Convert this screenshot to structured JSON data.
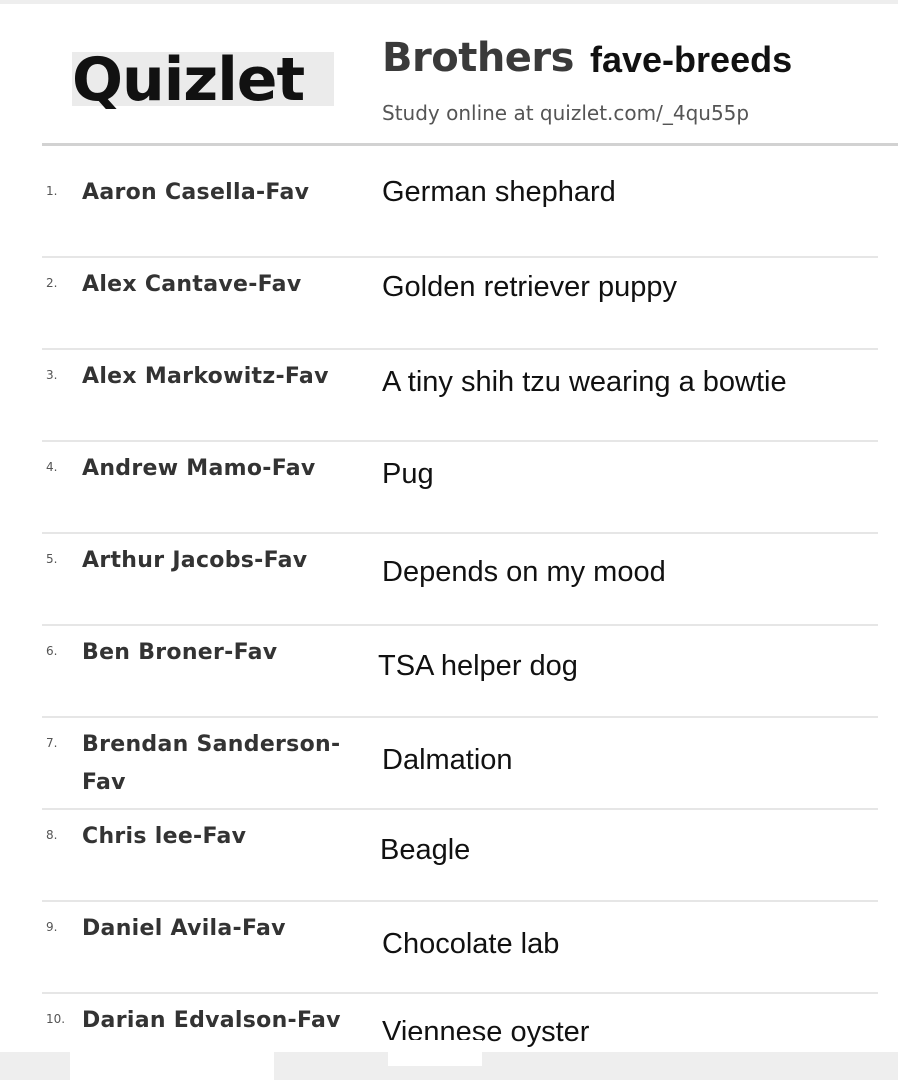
{
  "header": {
    "logo": "Quizlet",
    "set_title": "Brothers",
    "set_subtitle": "fave-breeds",
    "study_line": "Study online at quizlet.com/_4qu55p"
  },
  "cards": [
    {
      "num": "1.",
      "term": "Aaron Casella-Fav",
      "definition": "German shephard"
    },
    {
      "num": "2.",
      "term": "Alex Cantave-Fav",
      "definition": "Golden retriever puppy"
    },
    {
      "num": "3.",
      "term": "Alex Markowitz-Fav",
      "definition": "A tiny shih tzu wearing a bowtie"
    },
    {
      "num": "4.",
      "term": "Andrew Mamo-Fav",
      "definition": "Pug"
    },
    {
      "num": "5.",
      "term": "Arthur Jacobs-Fav",
      "definition": "Depends on my mood"
    },
    {
      "num": "6.",
      "term": "Ben Broner-Fav",
      "definition": "TSA helper dog"
    },
    {
      "num": "7.",
      "term": "Brendan Sanderson-Fav",
      "definition": "Dalmation"
    },
    {
      "num": "8.",
      "term": "Chris lee-Fav",
      "definition": "Beagle"
    },
    {
      "num": "9.",
      "term": "Daniel Avila-Fav",
      "definition": "Chocolate lab"
    },
    {
      "num": "10.",
      "term": "Darian Edvalson-Fav",
      "definition": "Viennese oyster"
    }
  ]
}
